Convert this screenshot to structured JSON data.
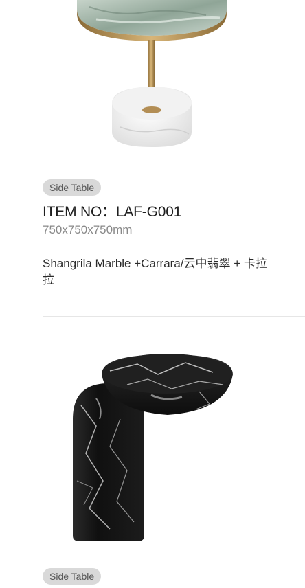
{
  "products": [
    {
      "tag": "Side Table",
      "item_no": "ITEM NO：LAF-G001",
      "dimensions": "750x750x750mm",
      "material": "Shangrila Marble +Carrara/云中翡翠 + 卡拉拉"
    },
    {
      "tag": "Side Table"
    }
  ],
  "colors": {
    "tag_bg": "#d9d9d9",
    "brass": "#c09a5a",
    "green_marble": "#a9bcb0",
    "black_marble": "#141414"
  }
}
